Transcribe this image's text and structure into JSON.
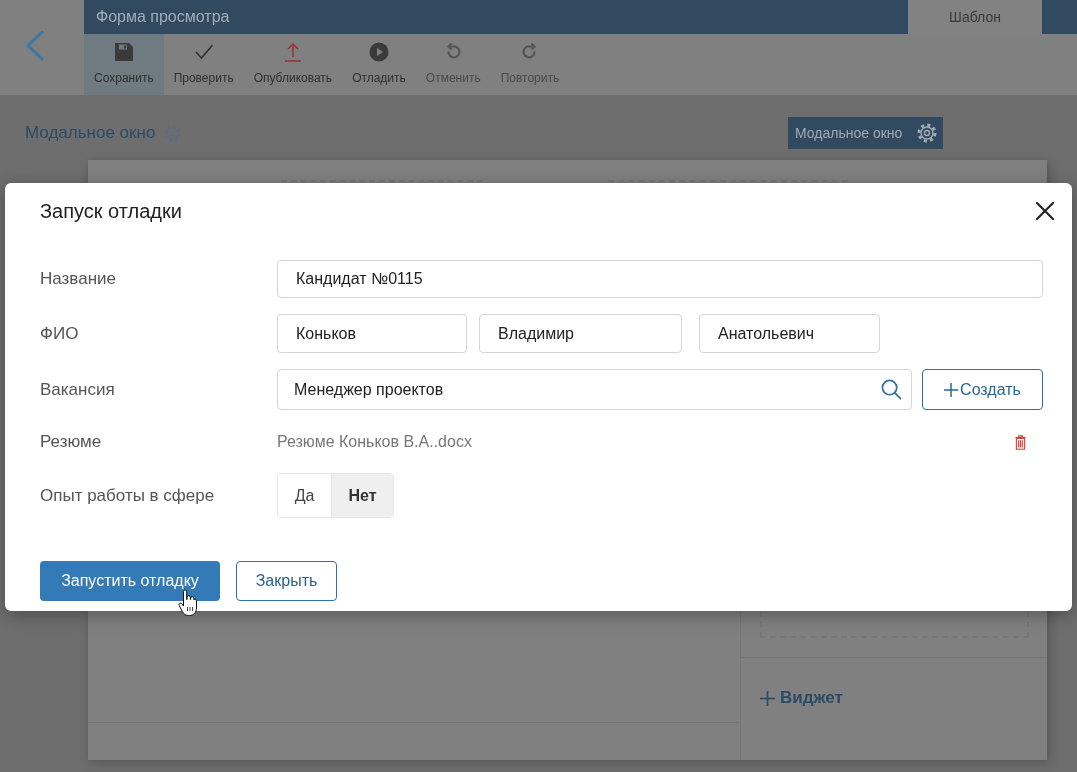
{
  "header": {
    "title": "Форма просмотра",
    "tabs": [
      {
        "label": "Шаблон",
        "selected": true
      }
    ]
  },
  "toolbar": [
    {
      "kind": "save",
      "label": "Сохранить",
      "selected": true,
      "disabled": false
    },
    {
      "kind": "check",
      "label": "Проверить",
      "selected": false,
      "disabled": false
    },
    {
      "kind": "publish",
      "label": "Опубликовать",
      "selected": false,
      "disabled": false
    },
    {
      "kind": "debug",
      "label": "Отладить",
      "selected": false,
      "disabled": false
    },
    {
      "kind": "undo",
      "label": "Отменить",
      "selected": false,
      "disabled": true
    },
    {
      "kind": "redo",
      "label": "Повторить",
      "selected": false,
      "disabled": true
    }
  ],
  "page": {
    "title": "Модальное окно",
    "chip": "Модальное окно",
    "add_widget": "Виджет"
  },
  "modal": {
    "title": "Запуск отладки",
    "fields": [
      {
        "kind": "text",
        "label": "Название",
        "value": "Кандидат №0115"
      },
      {
        "kind": "name",
        "label": "ФИО",
        "values": [
          "Коньков",
          "Владимир",
          "Анатольевич"
        ]
      },
      {
        "kind": "lookup",
        "label": "Вакансия",
        "value": "Менеджер проектов",
        "action": "Создать"
      },
      {
        "kind": "file",
        "label": "Резюме",
        "file": "Резюме Коньков В.А..docx"
      },
      {
        "kind": "toggle",
        "label": "Опыт работы в сфере",
        "options": [
          {
            "label": "Да",
            "selected": false
          },
          {
            "label": "Нет",
            "selected": true
          }
        ]
      }
    ],
    "buttons": [
      {
        "kind": "primary",
        "label": "Запустить отладку"
      },
      {
        "kind": "secondary",
        "label": "Закрыть"
      }
    ]
  }
}
